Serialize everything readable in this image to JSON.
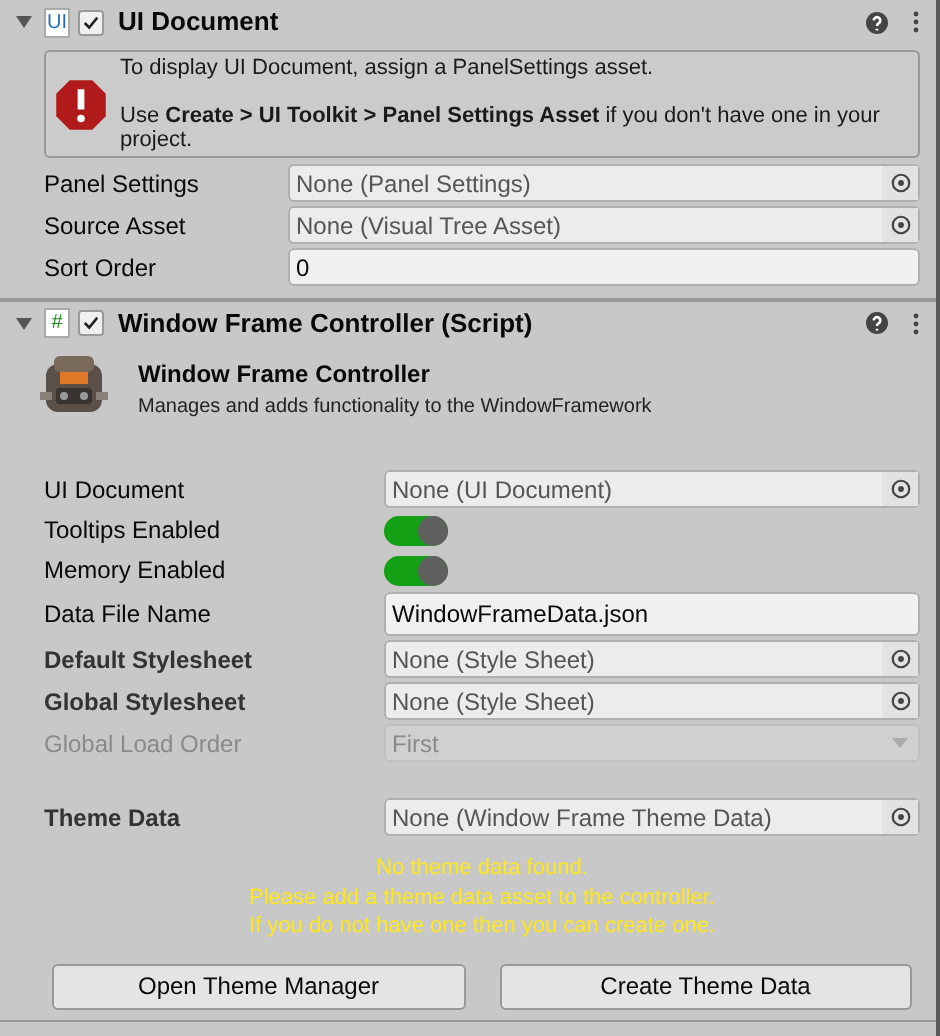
{
  "components": [
    {
      "kind": "ui_document",
      "icon_text": "UI",
      "enabled": true,
      "expanded": true,
      "title": "UI Document",
      "help_box": {
        "lines": [
          "To display UI Document, assign a PanelSettings asset.",
          "Use **Create > UI Toolkit > Panel Settings Asset** if you don't have one in your project."
        ]
      },
      "fields": [
        {
          "kind": "object",
          "label": "Panel Settings",
          "value": "None (Panel Settings)"
        },
        {
          "kind": "object",
          "label": "Source Asset",
          "value": "None (Visual Tree Asset)"
        },
        {
          "kind": "text",
          "label": "Sort Order",
          "value": "0"
        }
      ]
    },
    {
      "kind": "script",
      "icon_text": "#",
      "enabled": true,
      "expanded": true,
      "title": "Window Frame Controller (Script)",
      "info": {
        "title": "Window Frame Controller",
        "description": "Manages and adds functionality to the WindowFramework"
      },
      "fields": [
        {
          "kind": "object",
          "label": "UI Document",
          "value": "None (UI Document)",
          "overridden": false,
          "disabled": false
        },
        {
          "kind": "toggle",
          "label": "Tooltips Enabled",
          "on": true,
          "overridden": false,
          "disabled": false
        },
        {
          "kind": "toggle",
          "label": "Memory Enabled",
          "on": true,
          "overridden": false,
          "disabled": false
        },
        {
          "kind": "text",
          "label": "Data File Name",
          "value": "WindowFrameData.json",
          "overridden": false,
          "disabled": false
        },
        {
          "kind": "object",
          "label": "Default Stylesheet",
          "value": "None (Style Sheet)",
          "overridden": true,
          "disabled": false
        },
        {
          "kind": "object",
          "label": "Global Stylesheet",
          "value": "None (Style Sheet)",
          "overridden": true,
          "disabled": false
        },
        {
          "kind": "dropdown",
          "label": "Global Load Order",
          "value": "First",
          "overridden": false,
          "disabled": true
        },
        {
          "kind": "spacer"
        },
        {
          "kind": "object",
          "label": "Theme Data",
          "value": "None (Window Frame Theme Data)",
          "overridden": true,
          "disabled": false
        }
      ],
      "warning": [
        "No theme data found.",
        "Please add a theme data asset to the controller.",
        "If you do not have one then you can create one."
      ],
      "buttons": [
        "Open Theme Manager",
        "Create Theme Data"
      ]
    }
  ]
}
